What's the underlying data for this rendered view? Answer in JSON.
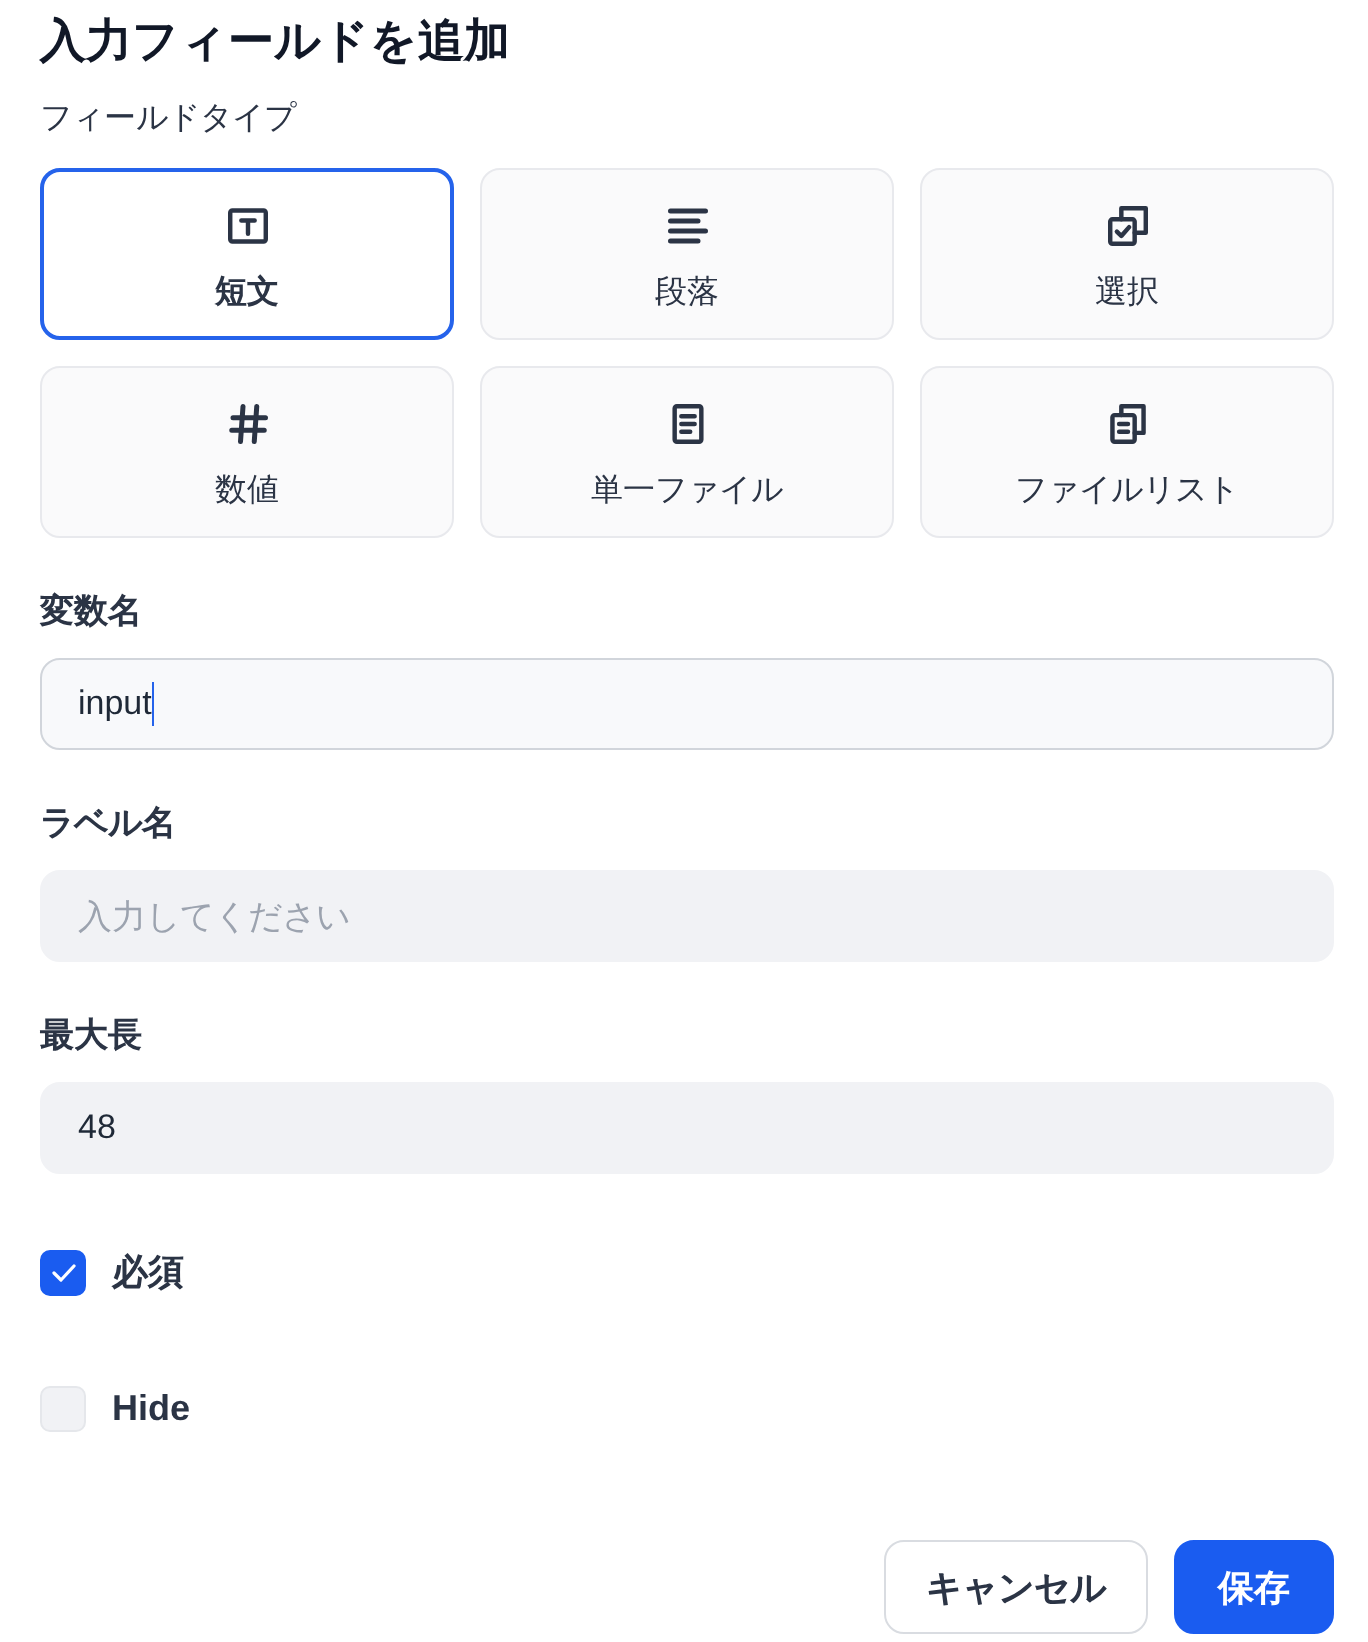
{
  "title": "入力フィールドを追加",
  "field_type": {
    "label": "フィールドタイプ",
    "options": [
      {
        "kind": "short_text",
        "label": "短文",
        "selected": true
      },
      {
        "kind": "paragraph",
        "label": "段落",
        "selected": false
      },
      {
        "kind": "select",
        "label": "選択",
        "selected": false
      },
      {
        "kind": "number",
        "label": "数値",
        "selected": false
      },
      {
        "kind": "file",
        "label": "単一ファイル",
        "selected": false
      },
      {
        "kind": "file_list",
        "label": "ファイルリスト",
        "selected": false
      }
    ]
  },
  "fields": [
    {
      "label": "変数名",
      "value": "input",
      "focused": true
    },
    {
      "label": "ラベル名",
      "placeholder": "入力してください",
      "focused": false
    },
    {
      "label": "最大長",
      "value": "48",
      "focused": false
    }
  ],
  "checkboxes": [
    {
      "label": "必須",
      "checked": true
    },
    {
      "label": "Hide",
      "checked": false
    }
  ],
  "buttons": [
    {
      "kind": "secondary",
      "label": "キャンセル"
    },
    {
      "kind": "primary",
      "label": "保存"
    }
  ]
}
